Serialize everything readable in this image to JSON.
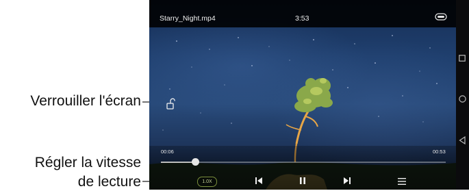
{
  "video": {
    "file_name": "Starry_Night.mp4",
    "clock": "3:53",
    "elapsed": "00:06",
    "total": "00:53",
    "progress": 0.12,
    "speed": "1.0X"
  },
  "callouts": {
    "lock_screen": "Verrouiller l'écran",
    "speed_line1": "Régler la vitesse",
    "speed_line2": "de lecture"
  },
  "icons": {
    "menu": "menu-pill-icon",
    "lock": "lock-open-icon",
    "prev": "skip-previous-icon",
    "pause": "pause-icon",
    "next": "skip-next-icon",
    "playlist": "playlist-icon",
    "nav_recent": "square-icon",
    "nav_home": "circle-icon",
    "nav_back": "triangle-back-icon"
  },
  "colors": {
    "speed_accent": "#7a8f3c",
    "bar_bg": "#000000"
  }
}
